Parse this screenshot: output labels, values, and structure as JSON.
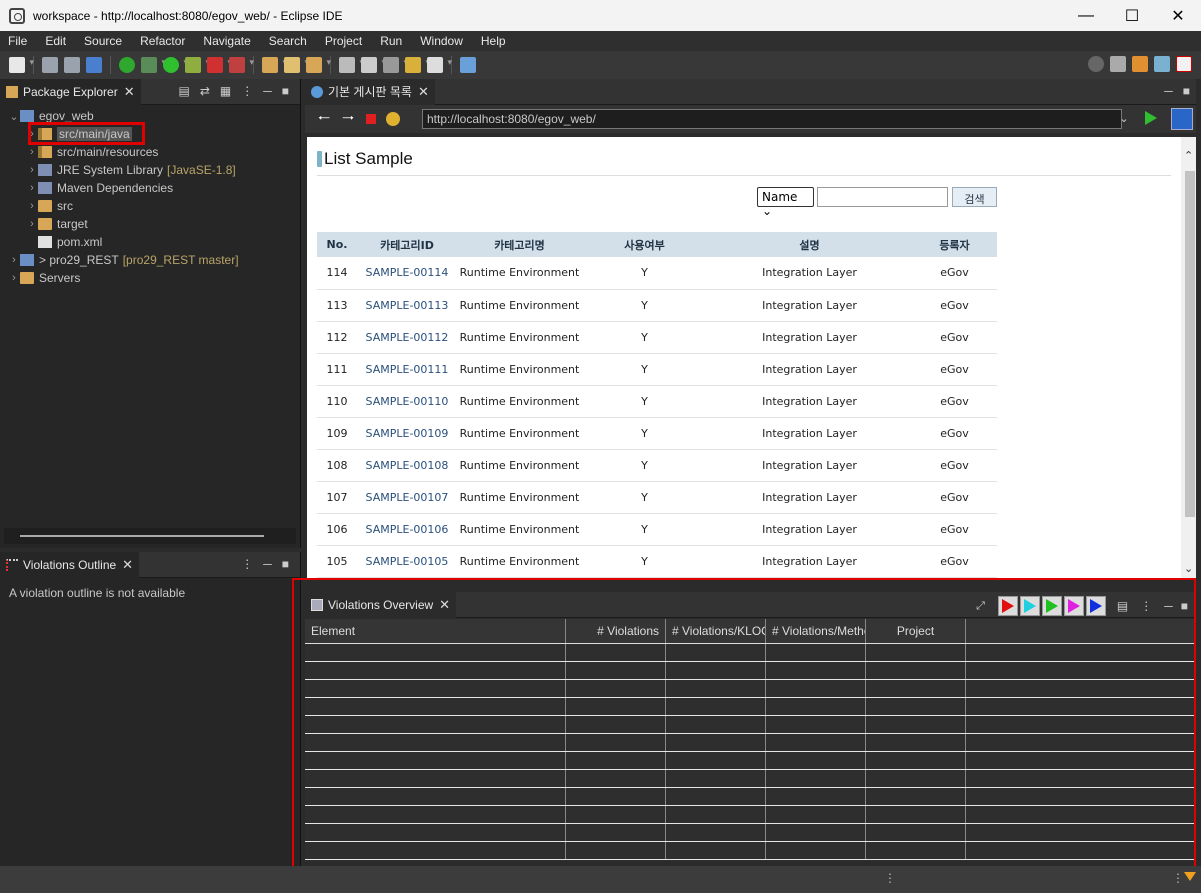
{
  "window": {
    "title": "workspace - http://localhost:8080/egov_web/ - Eclipse IDE"
  },
  "menu": [
    "File",
    "Edit",
    "Source",
    "Refactor",
    "Navigate",
    "Search",
    "Project",
    "Run",
    "Window",
    "Help"
  ],
  "package_explorer": {
    "tab_label": "Package Explorer",
    "tree": [
      {
        "label": "egov_web",
        "indent": 0,
        "icon": "project-icon",
        "expanded": true
      },
      {
        "label": "src/main/java",
        "indent": 1,
        "icon": "package-folder-icon",
        "selected": true
      },
      {
        "label": "src/main/resources",
        "indent": 1,
        "icon": "package-folder-icon"
      },
      {
        "label": "JRE System Library",
        "decor": "[JavaSE-1.8]",
        "indent": 1,
        "icon": "library-icon"
      },
      {
        "label": "Maven Dependencies",
        "indent": 1,
        "icon": "library-icon"
      },
      {
        "label": "src",
        "indent": 1,
        "icon": "folder-icon"
      },
      {
        "label": "target",
        "indent": 1,
        "icon": "folder-icon"
      },
      {
        "label": "pom.xml",
        "indent": 1,
        "icon": "maven-file-icon",
        "leaf": true
      },
      {
        "label": "> pro29_REST",
        "decor": "[pro29_REST master]",
        "indent": 0,
        "icon": "project-icon"
      },
      {
        "label": "Servers",
        "indent": 0,
        "icon": "folder-icon"
      }
    ]
  },
  "violations_outline": {
    "tab_label": "Violations Outline",
    "message": "A violation outline is not available"
  },
  "browser": {
    "tab_label": "기본 게시판 목록",
    "url": "http://localhost:8080/egov_web/",
    "page": {
      "title": "List Sample",
      "search_option": "Name",
      "search_button": "검색",
      "columns": [
        "No.",
        "카테고리ID",
        "카테고리명",
        "사용여부",
        "설명",
        "등록자"
      ],
      "rows": [
        [
          "114",
          "SAMPLE-00114",
          "Runtime Environment",
          "Y",
          "Integration Layer",
          "eGov"
        ],
        [
          "113",
          "SAMPLE-00113",
          "Runtime Environment",
          "Y",
          "Integration Layer",
          "eGov"
        ],
        [
          "112",
          "SAMPLE-00112",
          "Runtime Environment",
          "Y",
          "Integration Layer",
          "eGov"
        ],
        [
          "111",
          "SAMPLE-00111",
          "Runtime Environment",
          "Y",
          "Integration Layer",
          "eGov"
        ],
        [
          "110",
          "SAMPLE-00110",
          "Runtime Environment",
          "Y",
          "Integration Layer",
          "eGov"
        ],
        [
          "109",
          "SAMPLE-00109",
          "Runtime Environment",
          "Y",
          "Integration Layer",
          "eGov"
        ],
        [
          "108",
          "SAMPLE-00108",
          "Runtime Environment",
          "Y",
          "Integration Layer",
          "eGov"
        ],
        [
          "107",
          "SAMPLE-00107",
          "Runtime Environment",
          "Y",
          "Integration Layer",
          "eGov"
        ],
        [
          "106",
          "SAMPLE-00106",
          "Runtime Environment",
          "Y",
          "Integration Layer",
          "eGov"
        ],
        [
          "105",
          "SAMPLE-00105",
          "Runtime Environment",
          "Y",
          "Integration Layer",
          "eGov"
        ]
      ]
    }
  },
  "violations_overview": {
    "tab_label": "Violations Overview",
    "columns": [
      "Element",
      "# Violations",
      "# Violations/KLOC",
      "# Violations/Method",
      "Project"
    ],
    "run_colors": [
      "#e01010",
      "#20d0e0",
      "#20c020",
      "#e020e0",
      "#1030e0"
    ]
  },
  "colors": {
    "highlight": "#e00000"
  }
}
